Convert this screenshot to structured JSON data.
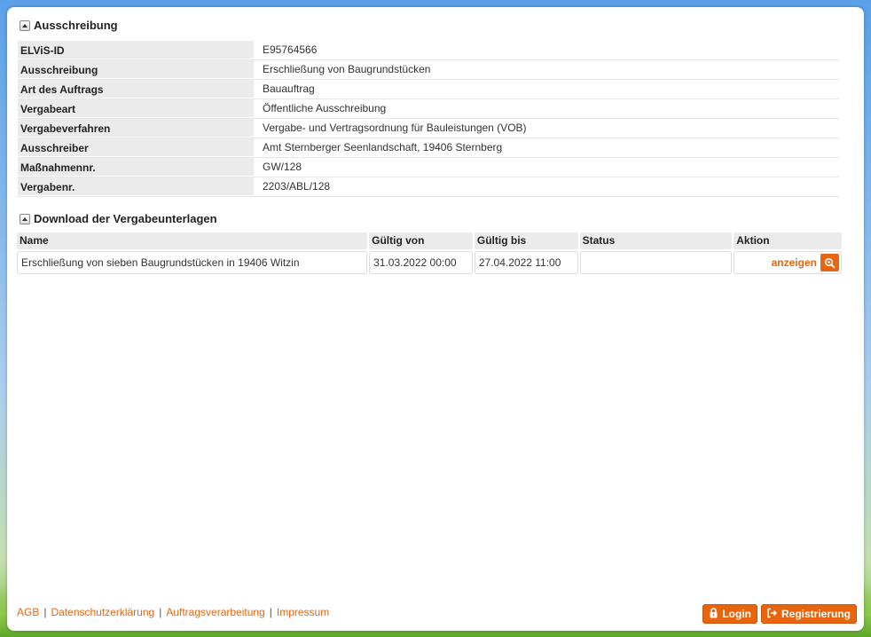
{
  "sections": {
    "ausschreibung_title": "Ausschreibung",
    "download_title": "Download der Vergabeunterlagen"
  },
  "info": [
    {
      "label": "ELViS-ID",
      "value": "E95764566"
    },
    {
      "label": "Ausschreibung",
      "value": "Erschließung von Baugrundstücken"
    },
    {
      "label": "Art des Auftrags",
      "value": "Bauauftrag"
    },
    {
      "label": "Vergabeart",
      "value": "Öffentliche Ausschreibung"
    },
    {
      "label": "Vergabeverfahren",
      "value": "Vergabe- und Vertragsordnung für Bauleistungen (VOB)"
    },
    {
      "label": "Ausschreiber",
      "value": "Amt Sternberger Seenlandschaft, 19406 Sternberg"
    },
    {
      "label": "Maßnahmennr.",
      "value": "GW/128"
    },
    {
      "label": "Vergabenr.",
      "value": "2203/ABL/128"
    }
  ],
  "download_table": {
    "headers": [
      "Name",
      "Gültig von",
      "Gültig bis",
      "Status",
      "Aktion"
    ],
    "rows": [
      {
        "name": "Erschließung von sieben Baugrundstücken in 19406 Witzin",
        "valid_from": "31.03.2022 00:00",
        "valid_to": "27.04.2022 11:00",
        "status": "",
        "action_label": "anzeigen",
        "action_icon": "eye-icon"
      }
    ]
  },
  "footer": {
    "links": [
      "AGB",
      "Datenschutzerklärung",
      "Auftragsverarbeitung",
      "Impressum"
    ],
    "separator": "|",
    "login_label": "Login",
    "login_icon": "lock-icon",
    "register_label": "Registrierung",
    "register_icon": "sign-in-icon"
  },
  "colors": {
    "accent": "#e8650e",
    "label_bg": "#ebebeb"
  }
}
